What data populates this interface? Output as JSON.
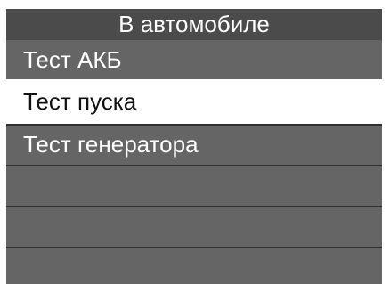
{
  "header": {
    "title": "В автомобиле"
  },
  "menu": {
    "items": [
      {
        "label": "Тест АКБ",
        "selected": false
      },
      {
        "label": "Тест пуска",
        "selected": true
      },
      {
        "label": "Тест генератора",
        "selected": false
      },
      {
        "label": "",
        "selected": false
      },
      {
        "label": "",
        "selected": false
      },
      {
        "label": "",
        "selected": false
      }
    ]
  },
  "colors": {
    "header_bg": "#4b4b4b",
    "item_bg": "#656565",
    "selected_bg": "#ffffff",
    "separator": "#2f2f2f"
  }
}
